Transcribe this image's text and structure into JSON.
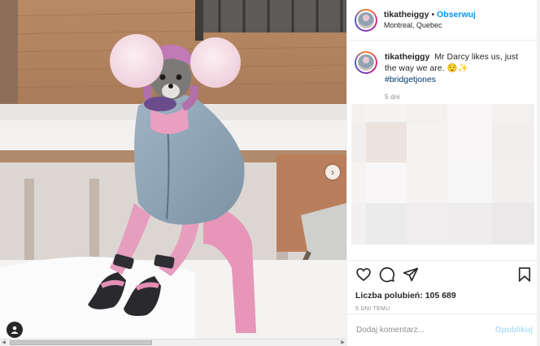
{
  "post": {
    "username": "tikatheiggy",
    "follow_label": "Obserwuj",
    "separator": "•",
    "location": "Montreal, Quebec"
  },
  "caption": {
    "username": "tikatheiggy",
    "text": "Mr Darcy likes us, just the way we are. 😌✨",
    "hashtag": "#bridgetjones",
    "time": "5 dni"
  },
  "stats": {
    "likes_label": "Liczba polubień:",
    "likes_count": "105 689",
    "date": "5 DNI TEMU"
  },
  "comment": {
    "placeholder": "Dodaj komentarz...",
    "publish_label": "Opublikuj"
  },
  "icons": {
    "like": "heart-icon",
    "comment": "comment-icon",
    "share": "share-icon",
    "save": "bookmark-icon",
    "next": "chevron-right-icon",
    "tag": "user-tag-icon"
  },
  "colors": {
    "link": "#0095f6",
    "hashtag": "#00376b",
    "publish_disabled": "#b2dffc",
    "muted": "#8e8e8e"
  }
}
